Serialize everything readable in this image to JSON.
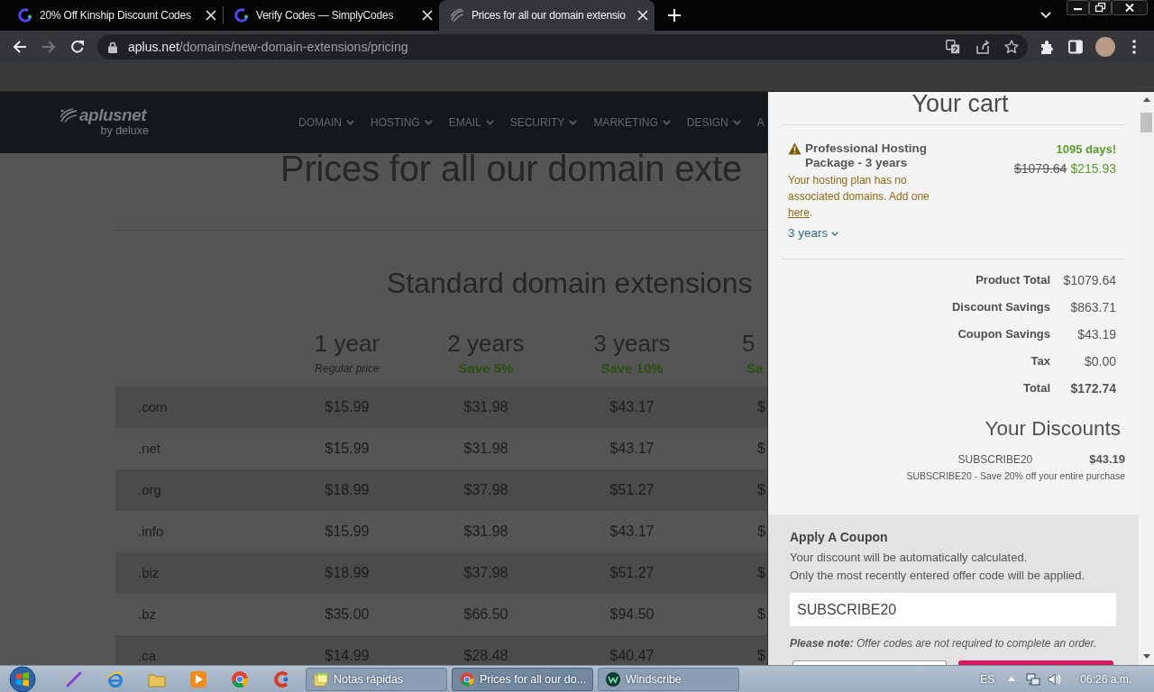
{
  "browser": {
    "tabs": [
      {
        "title": "20% Off Kinship Discount Codes",
        "selected": false
      },
      {
        "title": "Verify Codes — SimplyCodes",
        "selected": false
      },
      {
        "title": "Prices for all our domain extensio",
        "selected": true
      }
    ],
    "nav_buttons": [
      {
        "kind": "back",
        "disabled": false
      },
      {
        "kind": "forward",
        "disabled": true
      },
      {
        "kind": "reload",
        "disabled": false
      }
    ],
    "address": {
      "host": "aplus.net",
      "path": "/domains/new-domain-extensions/pricing"
    }
  },
  "site": {
    "logo": {
      "name": "aplusnet",
      "tagline": "by deluxe"
    },
    "nav": [
      {
        "label": "DOMAIN",
        "kind": "menu"
      },
      {
        "label": "HOSTING",
        "kind": "menu"
      },
      {
        "label": "EMAIL",
        "kind": "menu"
      },
      {
        "label": "SECURITY",
        "kind": "menu"
      },
      {
        "label": "MARKETING",
        "kind": "menu"
      },
      {
        "label": "DESIGN",
        "kind": "menu"
      },
      {
        "label": "A",
        "kind": "cut"
      }
    ],
    "page_title": "Prices for all our domain exte",
    "section_title": "Standard domain extensions",
    "columns": [
      {
        "term": "1 year",
        "note": "Regular price",
        "kind": "regular"
      },
      {
        "term": "2 years",
        "note": "Save 5%",
        "kind": "saving"
      },
      {
        "term": "3 years",
        "note": "Save 10%",
        "kind": "saving"
      },
      {
        "term": "5",
        "note": "Sa",
        "kind": "saving"
      }
    ],
    "rows": [
      {
        "extension": ".com",
        "prices": [
          "$15.99",
          "$31.98",
          "$43.17",
          "$"
        ]
      },
      {
        "extension": ".net",
        "prices": [
          "$15.99",
          "$31.98",
          "$43.17",
          "$"
        ]
      },
      {
        "extension": ".org",
        "prices": [
          "$18.99",
          "$37.98",
          "$51.27",
          "$"
        ]
      },
      {
        "extension": ".info",
        "prices": [
          "$15.99",
          "$31.98",
          "$43.17",
          "$"
        ]
      },
      {
        "extension": ".biz",
        "prices": [
          "$18.99",
          "$37.98",
          "$51.27",
          "$"
        ]
      },
      {
        "extension": ".bz",
        "prices": [
          "$35.00",
          "$66.50",
          "$94.50",
          "$"
        ]
      },
      {
        "extension": ".ca",
        "prices": [
          "$14.99",
          "$28.48",
          "$40.47",
          "$"
        ]
      }
    ]
  },
  "cart": {
    "title": "Your cart",
    "item": {
      "name": "Professional Hosting Package - 3 years",
      "warning": {
        "text": "Your hosting plan has no associated domains. Add one ",
        "link": "here",
        "end": "."
      },
      "term": "3 years",
      "promo": "1095 days!",
      "old_price": "$1079.64",
      "price": "$215.93"
    },
    "totals": [
      {
        "label": "Product Total",
        "value": "$1079.64",
        "kind": "line"
      },
      {
        "label": "Discount Savings",
        "value": "$863.71",
        "kind": "line"
      },
      {
        "label": "Coupon Savings",
        "value": "$43.19",
        "kind": "line"
      },
      {
        "label": "Tax",
        "value": "$0.00",
        "kind": "line"
      },
      {
        "label": "Total",
        "value": "$172.74",
        "kind": "grand"
      }
    ],
    "discounts_title": "Your Discounts",
    "discounts": [
      {
        "code": "SUBSCRIBE20",
        "amount": "$43.19",
        "description": "SUBSCRIBE20 - Save 20% off your entire purchase"
      }
    ],
    "coupon": {
      "title": "Apply A Coupon",
      "lines": [
        "Your discount will be automatically calculated.",
        "Only the most recently entered offer code will be applied."
      ],
      "value": "SUBSCRIBE20",
      "note": "**Please note:** Offer codes are not required to complete an order."
    }
  },
  "taskbar": {
    "tasks": [
      {
        "label": "Notas rápidas",
        "selected": false
      },
      {
        "label": "Prices for all our do...",
        "selected": true
      },
      {
        "label": "Windscribe",
        "selected": false
      }
    ],
    "language": "ES",
    "clock": "06:26 a.m."
  }
}
